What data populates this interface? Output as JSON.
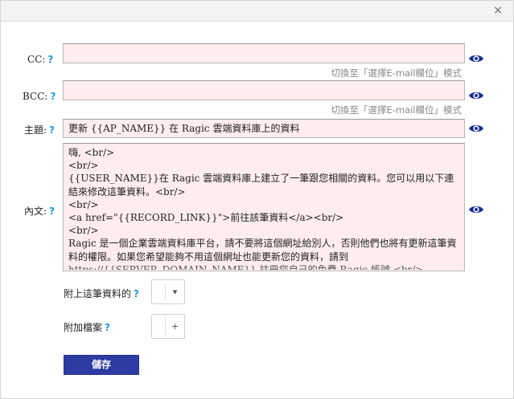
{
  "dialog": {
    "close_glyph": "×"
  },
  "help_mark": "?",
  "cc": {
    "label": "CC:",
    "value": "",
    "toggle": "切換至「選擇E-mail欄位」模式"
  },
  "bcc": {
    "label": "BCC:",
    "value": "",
    "toggle": "切換至「選擇E-mail欄位」模式"
  },
  "subject": {
    "label": "主題:",
    "value": "更新 {{AP_NAME}} 在 Ragic 雲端資料庫上的資料"
  },
  "body": {
    "label": "內文:",
    "lines": [
      "嗨, <br/>",
      "<br/>",
      "{{USER_NAME}}在 Ragic 雲端資料庫上建立了一筆跟您相關的資料。您可以用以下連結來修改這筆資料。<br/>",
      "<br/>",
      "<a href=\"{{RECORD_LINK}}\">前往該筆資料</a><br/>",
      "<br/>",
      "Ragic 是一個企業雲端資料庫平台，請不要將這個網址給別人，否則他們也將有更新這筆資料的權限。如果您希望能夠不用這個網址也能更新您的資料，請到",
      "https://{{SERVER_DOMAIN_NAME}} 註冊您自己的免費 Ragic 帳號 <br/>"
    ]
  },
  "attach_record": {
    "label": "附上這筆資料的",
    "button_glyph": "▾"
  },
  "attach_file": {
    "label": "附加檔案",
    "button_glyph": "+"
  },
  "save_button": {
    "label": "儲存"
  },
  "colors": {
    "field_bg": "#ffeded",
    "help": "#1a9be0",
    "eye": "#1b2f8e",
    "save": "#2e3ba3"
  },
  "icons": {
    "eye": "eye-icon",
    "close": "close-icon",
    "dropdown": "chevron-down-icon",
    "add": "plus-icon"
  }
}
